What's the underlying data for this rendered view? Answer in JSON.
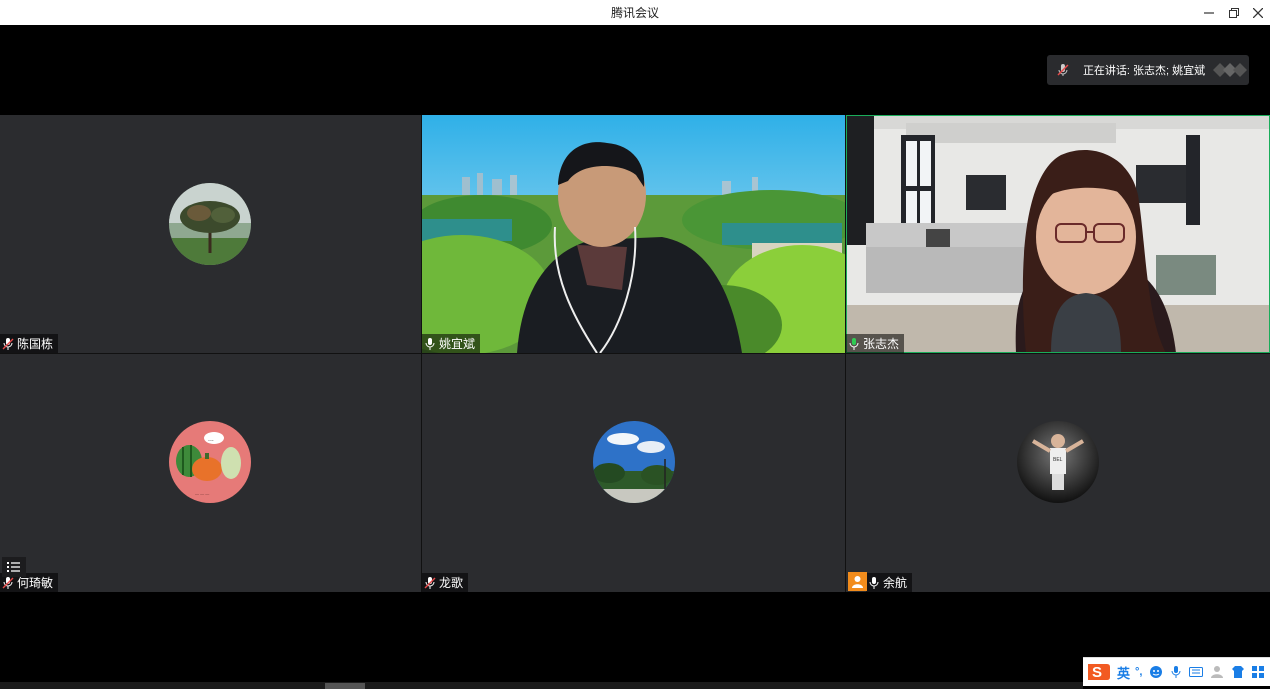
{
  "window": {
    "title": "腾讯会议"
  },
  "speaking": {
    "label": "正在讲话: 张志杰; 姚宜斌"
  },
  "participants": [
    {
      "name": "陈国栋"
    },
    {
      "name": "姚宜斌"
    },
    {
      "name": "张志杰"
    },
    {
      "name": "何琦敏"
    },
    {
      "name": "龙歌"
    },
    {
      "name": "余航"
    }
  ],
  "ime": {
    "mode": "英",
    "punct": "°,"
  },
  "colors": {
    "active_border": "#1aad5a",
    "mic_active": "#ffffff",
    "mic_muted": "#e84a4a",
    "host_badge": "#f28c1c"
  }
}
